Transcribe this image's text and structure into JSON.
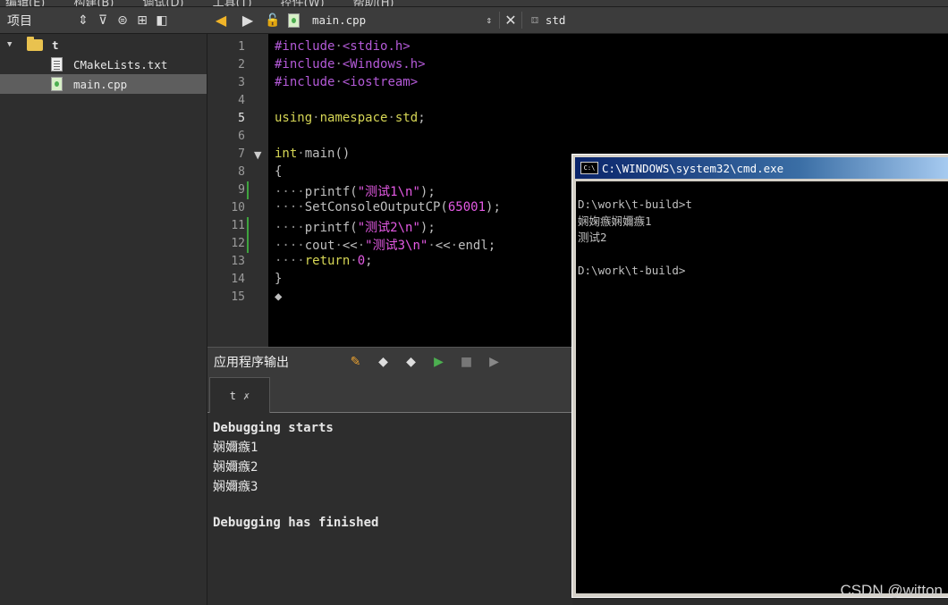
{
  "menubar": {
    "items": [
      "编辑(E)",
      "构建(B)",
      "调试(D)",
      "工具(T)",
      "控件(W)",
      "帮助(H)"
    ]
  },
  "project_pane": {
    "title": "项目",
    "tree": [
      {
        "label": "t",
        "kind": "folder"
      },
      {
        "label": "CMakeLists.txt",
        "kind": "file"
      },
      {
        "label": "main.cpp",
        "kind": "cpp",
        "selected": true
      }
    ]
  },
  "editor_toolbar": {
    "file": "main.cpp",
    "symbol": "std"
  },
  "editor": {
    "line_numbers": [
      "1",
      "2",
      "3",
      "4",
      "5",
      "6",
      "7",
      "8",
      "9",
      "10",
      "11",
      "12",
      "13",
      "14",
      "15"
    ],
    "lines": [
      [
        [
          "pp",
          "#include"
        ],
        [
          "dot",
          "·"
        ],
        [
          "pp",
          "<stdio.h>"
        ]
      ],
      [
        [
          "pp",
          "#include"
        ],
        [
          "dot",
          "·"
        ],
        [
          "pp",
          "<Windows.h>"
        ]
      ],
      [
        [
          "pp",
          "#include"
        ],
        [
          "dot",
          "·"
        ],
        [
          "pp",
          "<iostream>"
        ]
      ],
      [],
      [
        [
          "kw",
          "using"
        ],
        [
          "dot",
          "·"
        ],
        [
          "kw",
          "namespace"
        ],
        [
          "dot",
          "·"
        ],
        [
          "kw",
          "std"
        ],
        [
          "p",
          ";"
        ]
      ],
      [],
      [
        [
          "kw",
          "int"
        ],
        [
          "dot",
          "·"
        ],
        [
          "p",
          "main()"
        ]
      ],
      [
        [
          "p",
          "{"
        ]
      ],
      [
        [
          "dot",
          "····"
        ],
        [
          "p",
          "printf("
        ],
        [
          "str",
          "\"测试1\\n\""
        ],
        [
          "p",
          ");"
        ]
      ],
      [
        [
          "dot",
          "····"
        ],
        [
          "p",
          "SetConsoleOutputCP("
        ],
        [
          "num",
          "65001"
        ],
        [
          "p",
          ");"
        ]
      ],
      [
        [
          "dot",
          "····"
        ],
        [
          "p",
          "printf("
        ],
        [
          "str",
          "\"测试2\\n\""
        ],
        [
          "p",
          ");"
        ]
      ],
      [
        [
          "dot",
          "····"
        ],
        [
          "p",
          "cout"
        ],
        [
          "dot",
          "·"
        ],
        [
          "p",
          "<<"
        ],
        [
          "dot",
          "·"
        ],
        [
          "str",
          "\"测试3\\n\""
        ],
        [
          "dot",
          "·"
        ],
        [
          "p",
          "<<"
        ],
        [
          "dot",
          "·"
        ],
        [
          "p",
          "endl;"
        ]
      ],
      [
        [
          "dot",
          "····"
        ],
        [
          "kw",
          "return"
        ],
        [
          "dot",
          "·"
        ],
        [
          "num",
          "0"
        ],
        [
          "p",
          ";"
        ]
      ],
      [
        [
          "p",
          "}"
        ]
      ],
      [
        [
          "p",
          "◆"
        ]
      ]
    ]
  },
  "output_pane": {
    "title": "应用程序输出",
    "tab": "t",
    "lines": [
      {
        "text": "Debugging starts",
        "bold": true
      },
      {
        "text": "娴嬭瘯1",
        "bold": false
      },
      {
        "text": "娴嬭瘯2",
        "bold": false
      },
      {
        "text": "娴嬭瘯3",
        "bold": false
      },
      {
        "text": "",
        "bold": false
      },
      {
        "text": "Debugging has finished",
        "bold": true
      }
    ]
  },
  "cmd_window": {
    "icon_label": "C:\\",
    "title": "C:\\WINDOWS\\system32\\cmd.exe",
    "lines": [
      "D:\\work\\t-build>t",
      "娴婅瘯娴嬭瘯1",
      "测试2",
      "",
      "D:\\work\\t-build>"
    ]
  },
  "watermark": "CSDN @witton"
}
